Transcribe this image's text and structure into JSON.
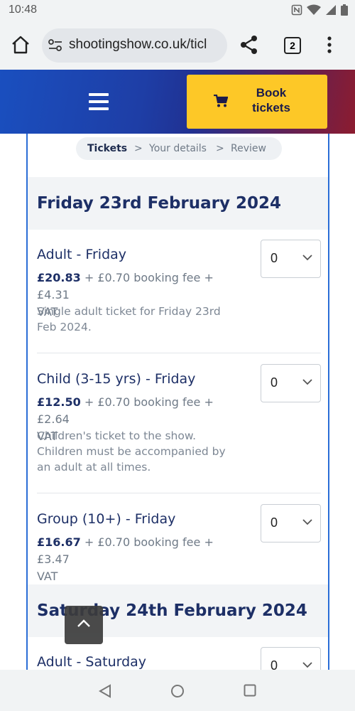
{
  "status": {
    "time": "10:48"
  },
  "browser": {
    "url": "shootingshow.co.uk/ticl",
    "tab_count": "2"
  },
  "header": {
    "book_label_line1": "Book",
    "book_label_line2": "tickets"
  },
  "steps": {
    "step1": "Tickets",
    "step2": "Your details",
    "step3": "Review",
    "separator": ">"
  },
  "days": [
    {
      "title": "Friday 23rd February 2024",
      "tickets": [
        {
          "name": "Adult - Friday",
          "price": "£20.83",
          "fees_line1": " + £0.70 booking fee + £4.31",
          "fees_line2": "VAT",
          "desc_line1": "Single adult ticket for Friday 23rd",
          "desc_line2": "Feb 2024.",
          "desc_line3": "",
          "qty": "0"
        },
        {
          "name": "Child (3-15 yrs) - Friday",
          "price": "£12.50",
          "fees_line1": " + £0.70 booking fee + £2.64",
          "fees_line2": "VAT",
          "desc_line1": "Children's ticket to the show.",
          "desc_line2": "Children must be accompanied by",
          "desc_line3": "an adult at all times.",
          "qty": "0"
        },
        {
          "name": "Group (10+) - Friday",
          "price": "£16.67",
          "fees_line1": " + £0.70 booking fee + £3.47",
          "fees_line2": "VAT",
          "qty": "0"
        }
      ]
    },
    {
      "title": "Saturday 24th February 2024",
      "tickets": [
        {
          "name": "Adult - Saturday",
          "qty": "0"
        }
      ]
    }
  ],
  "icons": {
    "home": "home-icon",
    "tune": "site-settings-icon",
    "share": "share-icon",
    "menu": "more-vert-icon",
    "cart": "cart-icon",
    "chevron": "chevron-down-icon",
    "scroll_top": "chevron-up-icon"
  },
  "colors": {
    "accent": "#fdc827",
    "heading": "#1d2f66",
    "border": "#2a6dd6"
  }
}
